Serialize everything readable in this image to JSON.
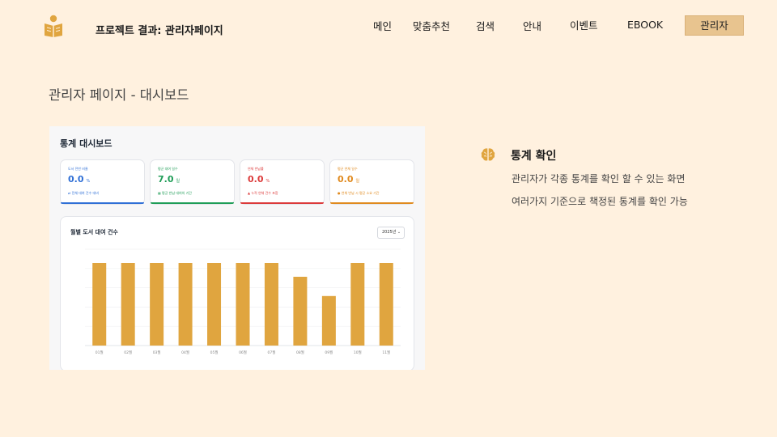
{
  "header": {
    "brand_title": "프로젝트 결과: 관리자페이지",
    "nav": [
      "메인",
      "맞춤추천",
      "검색",
      "안내",
      "이벤트",
      "EBOOK"
    ],
    "admin_button": "관리자"
  },
  "page_heading": "관리자 페이지 - 대시보드",
  "dashboard": {
    "title": "통계 대시보드",
    "cards": [
      {
        "label": "도서 전반 비율",
        "value": "0.0",
        "unit": "%",
        "note": "⇄ 전체 대여 건수 대비",
        "color": "#2f6fd6"
      },
      {
        "label": "평균 대여 일수",
        "value": "7.0",
        "unit": "일",
        "note": "▦ 평균 반납 대여의 기간",
        "color": "#1f9d57"
      },
      {
        "label": "연체 반납률",
        "value": "0.0",
        "unit": "%",
        "note": "▲ 누적 연체 건수 포함",
        "color": "#dc3a3a"
      },
      {
        "label": "평균 연체 일수",
        "value": "0.0",
        "unit": "일",
        "note": "● 연체 반납 시 평균 소요 기간",
        "color": "#e08a1e"
      }
    ],
    "chart_panel": {
      "title": "월별 도서 대여 건수",
      "year_select": "2025년"
    }
  },
  "chart_data": {
    "type": "bar",
    "title": "월별 도서 대여 건수",
    "categories": [
      "01월",
      "02월",
      "03월",
      "04월",
      "05월",
      "06월",
      "07월",
      "08월",
      "09월",
      "10월",
      "11월"
    ],
    "values": [
      6,
      6,
      6,
      6,
      6,
      6,
      6,
      5,
      3.6,
      6,
      6
    ],
    "ylim": [
      0,
      7
    ],
    "grid": true,
    "bar_color": "#e0a53f"
  },
  "feature": {
    "title": "통계 확인",
    "lines": [
      "관리자가 각종 통계를 확인 할 수 있는 화면",
      "여러가지 기준으로 책정된 통계를 확인 가능"
    ]
  },
  "colors": {
    "background": "#fff1df",
    "accent": "#e8c48f",
    "icon": "#e0a53f"
  }
}
